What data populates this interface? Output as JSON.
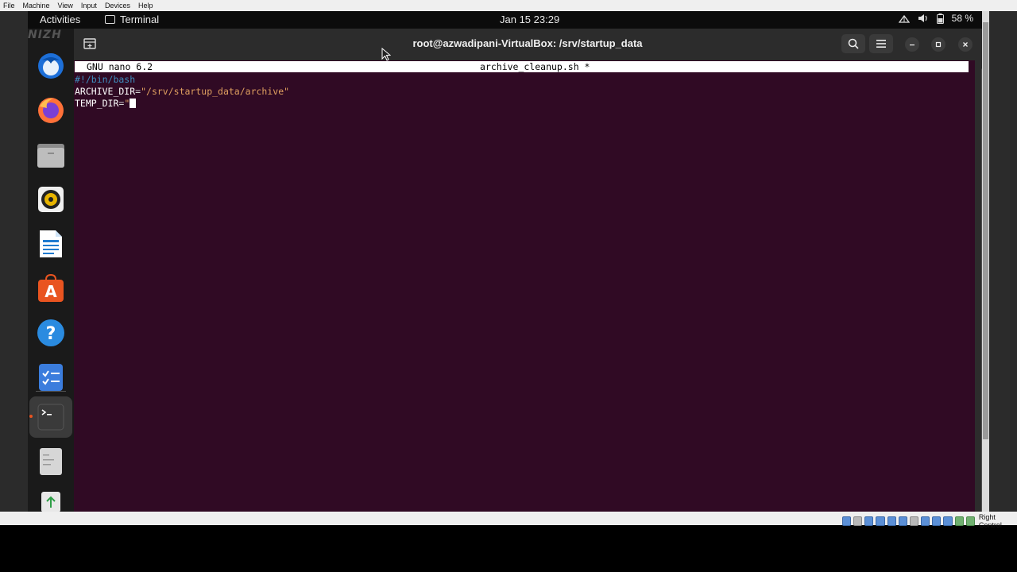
{
  "host_menu": [
    "File",
    "Machine",
    "View",
    "Input",
    "Devices",
    "Help"
  ],
  "topbar": {
    "activities": "Activities",
    "app_name": "Terminal",
    "clock": "Jan 15  23:29",
    "battery": "58 %"
  },
  "dock": {
    "items": [
      "thunderbird-icon",
      "firefox-icon",
      "files-icon",
      "rhythmbox-icon",
      "writer-icon",
      "app-center-icon",
      "help-icon",
      "todo-icon",
      "terminal-icon",
      "text-editor-icon",
      "trash-icon"
    ]
  },
  "window": {
    "title": "root@azwadipani-VirtualBox: /srv/startup_data"
  },
  "nano": {
    "version": "GNU nano 6.2",
    "filename": "archive_cleanup.sh *",
    "lines": {
      "shebang": "#!/bin/bash",
      "archive_var": "ARCHIVE_DIR",
      "archive_eq": "=",
      "archive_val": "\"/srv/startup_data/archive\"",
      "temp_var": "TEMP_DIR",
      "temp_eq": "=",
      "temp_val": "\""
    }
  },
  "status": {
    "host_key": "Right Control"
  },
  "colors": {
    "terminal_bg": "#300a24",
    "accent": "#e95420"
  }
}
